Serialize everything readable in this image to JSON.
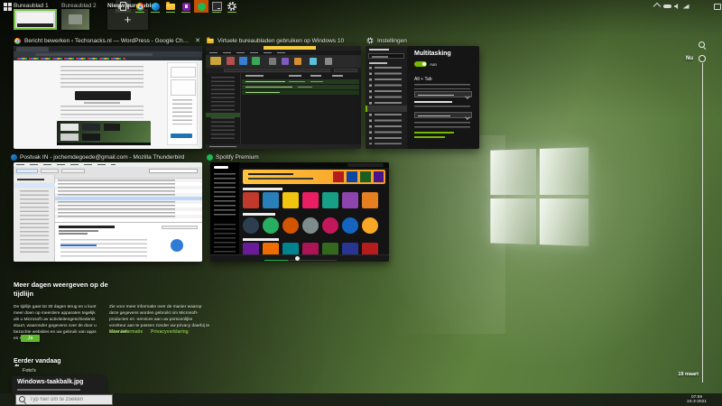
{
  "colors": {
    "accent_green": "#76b900",
    "link_green": "#7dbb43",
    "button_green": "#5fb82e",
    "desktop_active_border": "#79c143",
    "spotify_green": "#1db954",
    "flash_orange": "#c75000"
  },
  "desktops": {
    "desktop1_label": "Bureaublad 1",
    "desktop2_label": "Bureaublad 2",
    "new_desktop_label": "Nieuw bureaublad",
    "new_desktop_plus": "+"
  },
  "windows": {
    "chrome": {
      "title": "Bericht bewerken ‹ Techsnacks.nl — WordPress - Google Chrome",
      "close_glyph": "✕"
    },
    "explorer": {
      "title": "Virtuele bureaubladen gebruiken op Windows 10"
    },
    "settings": {
      "title": "Instellingen",
      "page_heading": "Multitasking",
      "toggle_state": "Aan",
      "section_alt_tab": "Alt + Tab"
    },
    "thunderbird": {
      "title": "Postvak IN - jochemdegoede@gmail.com - Mozilla Thunderbird"
    },
    "spotify": {
      "title": "Spotify Premium",
      "tiles_row1": [
        "#c0392b",
        "#2980b9",
        "#f1c40f",
        "#e91e63",
        "#16a085",
        "#8e44ad",
        "#e67e22"
      ],
      "tiles_row2": [
        "#2c3e50",
        "#27ae60",
        "#d35400",
        "#7f8c8d",
        "#c2185b",
        "#1565c0",
        "#f9a825"
      ],
      "tiles_row3": [
        "#6a1b9a",
        "#ef6c00",
        "#00838f",
        "#ad1457",
        "#33691e",
        "#283593",
        "#b71c1c"
      ]
    }
  },
  "timeline_promo": {
    "heading": "Meer dagen weergeven op de tijdlijn",
    "body_left": "De tijdlijn gaat tot 30 dagen terug en u kunt meer doen op meerdere apparaten tegelijk als u Microsoft uw activiteitengeschiedenis stuurt, waaronder gegevens over de door u bezochte websites en uw gebruik van apps en services.",
    "body_right": "Zie voor meer informatie over de manier waarop deze gegevens worden gebruikt om Microsoft-producten en -services aan uw persoonlijke voorkeur aan te passen zonder uw privacy daarbij te schenden:",
    "link_more": "Meer informatie",
    "link_privacy": "Privacyverklaring",
    "accept_label": "Ja"
  },
  "earlier_today": {
    "heading": "Eerder vandaag",
    "app_name": "Foto's",
    "item_title": "Windows-taakbalk.jpg"
  },
  "scrubber": {
    "now_label": "Nu",
    "start_label": "19 maart"
  },
  "taskbar": {
    "search_placeholder": "Typ hier om te zoeken",
    "time": "07:59",
    "date": "24-3-2021"
  }
}
